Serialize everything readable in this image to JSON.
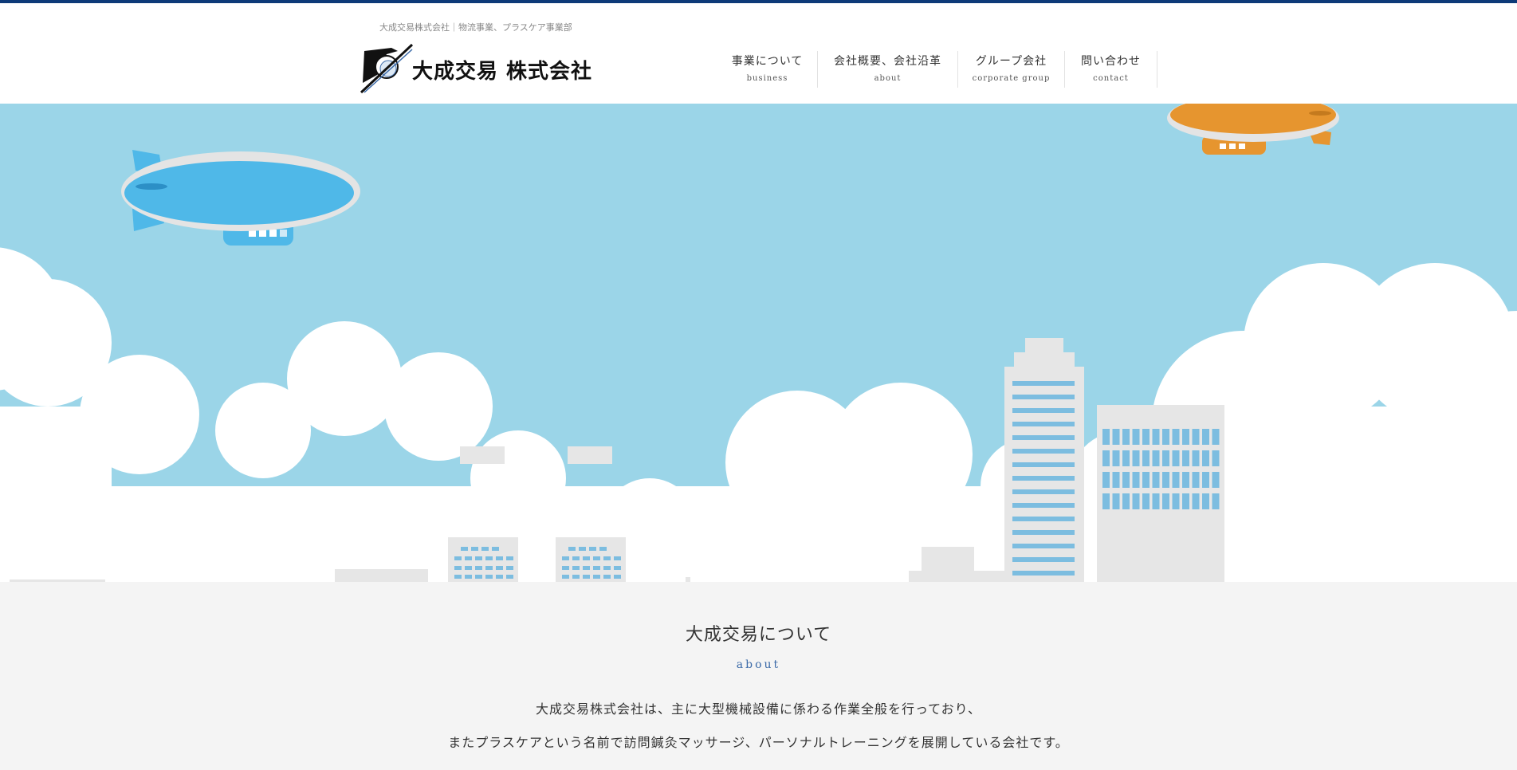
{
  "header": {
    "tagline": "大成交易株式会社｜物流事業、プラスケア事業部",
    "logo_text": "大成交易 株式会社"
  },
  "nav": {
    "items": [
      {
        "jp": "事業について",
        "en": "business"
      },
      {
        "jp": "会社概要、会社沿革",
        "en": "about"
      },
      {
        "jp": "グループ会社",
        "en": "corporate group"
      },
      {
        "jp": "問い合わせ",
        "en": "contact"
      }
    ]
  },
  "about": {
    "title": "大成交易について",
    "subtitle": "about",
    "line1": "大成交易株式会社は、主に大型機械設備に係わる作業全般を行っており、",
    "line2": "またプラスケアという名前で訪問鍼灸マッサージ、パーソナルトレーニングを展開している会社です。"
  },
  "colors": {
    "accent_bar": "#0d3a78",
    "sky": "#9bd5e8",
    "blimp_blue": "#4fb8e8",
    "blimp_orange": "#e6952f",
    "building_window": "#7cbde0"
  }
}
